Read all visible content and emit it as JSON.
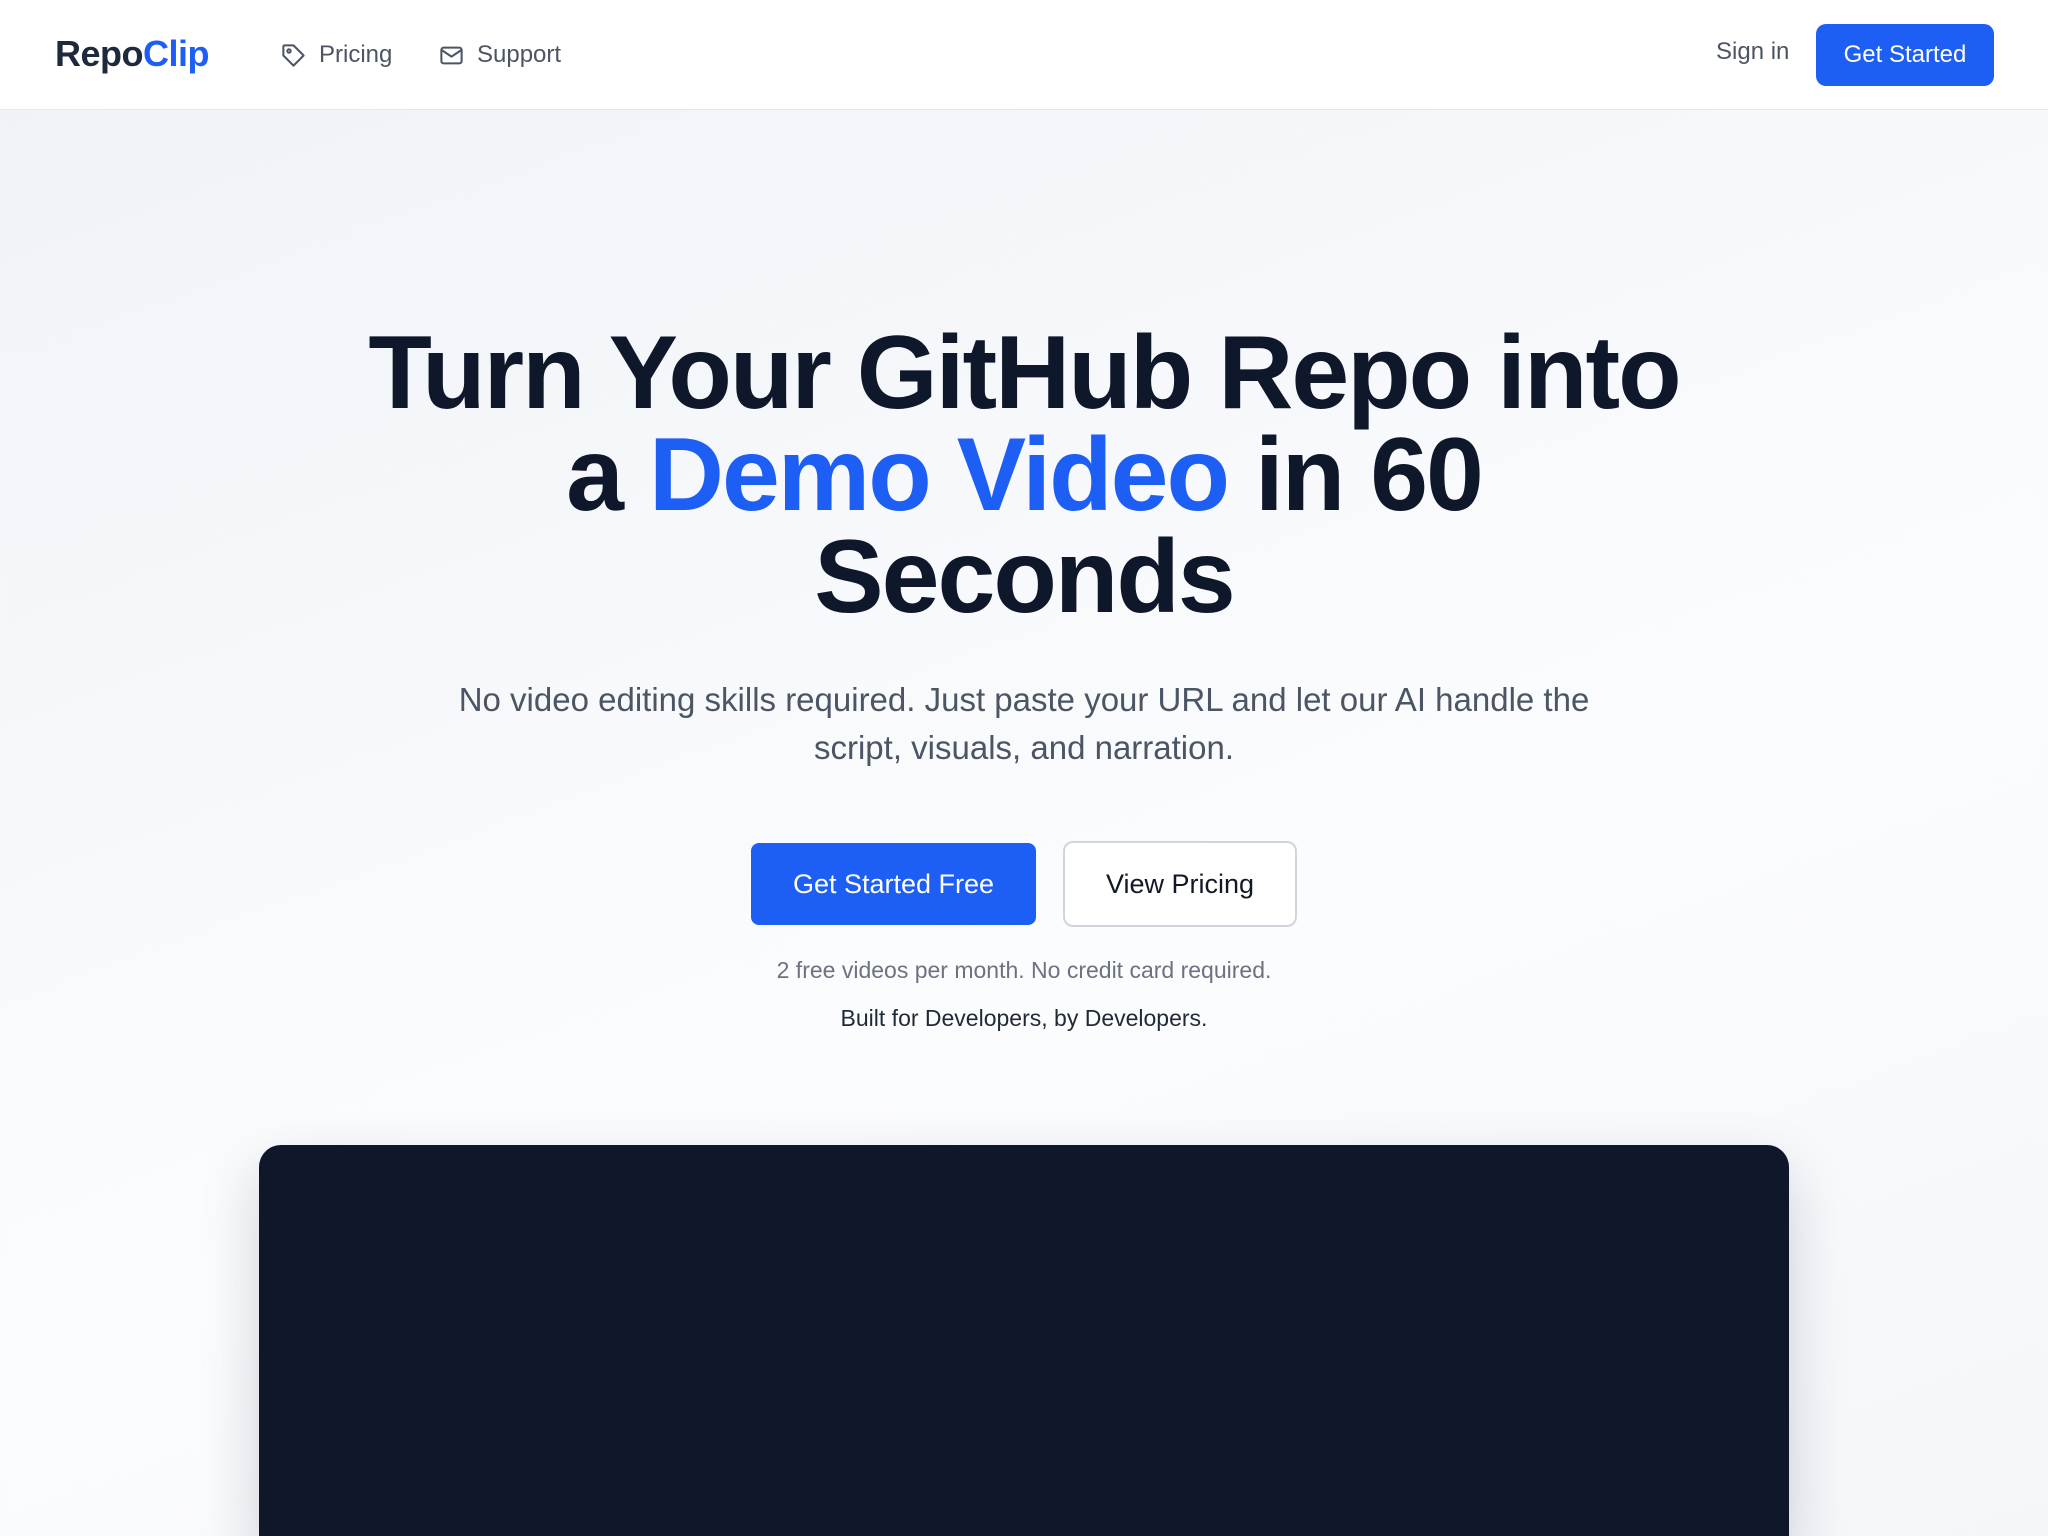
{
  "nav": {
    "logo_part1": "Repo",
    "logo_part2": "Clip",
    "links": [
      {
        "label": "Pricing",
        "icon": "tag-icon"
      },
      {
        "label": "Support",
        "icon": "mail-icon"
      }
    ],
    "signin_label": "Sign in",
    "cta_label": "Get Started"
  },
  "hero": {
    "title_line1": "Turn Your GitHub Repo into",
    "title_pre": "a",
    "title_accent": "Demo Video",
    "title_post": "in 60",
    "title_line3": "Seconds",
    "subtitle": "No video editing skills required. Just paste your URL and let our AI handle the script, visuals, and narration.",
    "primary_cta": "Get Started Free",
    "secondary_cta": "View Pricing",
    "note_free": "2 free videos per month. No credit card required.",
    "note_built": "Built for Developers, by Developers."
  },
  "colors": {
    "accent": "#1d5ef5",
    "heading": "#0f172a",
    "video_bg": "#0f172a"
  }
}
